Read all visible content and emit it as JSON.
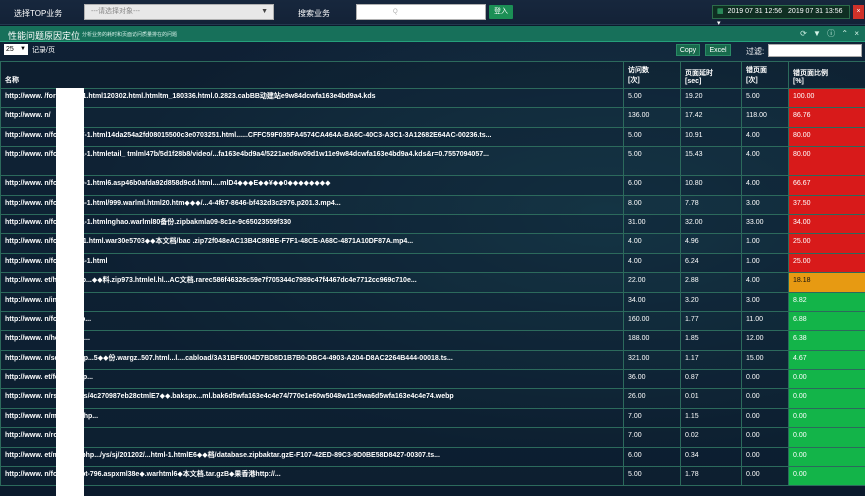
{
  "topbar": {
    "select_top_label": "选择TOP业务",
    "select_placeholder": "---请选择对象---",
    "search_label": "搜索业务",
    "search_value": "",
    "search_hint": "Q",
    "go_label": "登入",
    "time_start": "2019 07 31 12:56",
    "time_end": "2019 07 31 13:56",
    "time_caret": "▾",
    "close_label": "×"
  },
  "panel": {
    "title": "性能问题原因定位",
    "subtitle": "分析业务的耗时和页面访问质量排在的问题",
    "page_size": "25",
    "page_size_label": "记录/页",
    "copy_label": "Copy",
    "excel_label": "Excel",
    "filter_label": "过滤:"
  },
  "table": {
    "headers": {
      "name": "名称",
      "visits": "访问数",
      "visits_unit": "[次]",
      "delay": "页面延时",
      "delay_unit": "[sec]",
      "errors": "错页面",
      "errors_unit": "[次]",
      "ratio": "错页面比例",
      "ratio_unit": "[%]"
    },
    "rows": [
      {
        "name": "http://www.         /forum-131-1.html120302.html.htmltm_180336.html.0.2823.cabBB动建站e9w84dcwfa163e4bd9a4.kds",
        "visits": "5.00",
        "delay": "19.20",
        "errors": "5.00",
        "ratio": "100.00",
        "level": "red"
      },
      {
        "name": "http://www.         n/",
        "visits": "136.00",
        "delay": "17.42",
        "errors": "118.00",
        "ratio": "86.76",
        "level": "red"
      },
      {
        "name": "http://www.         n/forum-477-1.html14da254a2fd08015500c3e0703251.html......CFFC59F035FA4574CA464A-BA6C-40C3-A3C1-3A12682E64AC-00236.ts...",
        "visits": "5.00",
        "delay": "10.91",
        "errors": "4.00",
        "ratio": "80.00",
        "level": "red"
      },
      {
        "name": "http://www.         n/forum-231-1.htmletail_       tmlml47b/5d1f28b8/video/...fa163e4bd9a4/5221aed6w09d1w11e9w84dcwfa163e4bd9a4.kds&r=0.7557094057...",
        "visits": "5.00",
        "delay": "15.43",
        "errors": "4.00",
        "ratio": "80.00",
        "level": "red",
        "tall": true
      },
      {
        "name": "http://www.         n/forum-240-1.html6.asp46b0afda92d858d9cd.html....mlD4◆◆◆E◆◆¥◆◆0◆◆◆◆◆◆◆◆",
        "visits": "6.00",
        "delay": "10.80",
        "errors": "4.00",
        "ratio": "66.67",
        "level": "red"
      },
      {
        "name": "http://www.         n/forum-525-1.html/999.warlml.html20.htm◆◆◆/...4-4f67-8646-bf432d3c2976.p201.3.mp4...",
        "visits": "8.00",
        "delay": "7.78",
        "errors": "3.00",
        "ratio": "37.50",
        "level": "red"
      },
      {
        "name": "http://www.         n/forum-251-1.htmlnghao.warlml80备份.zipbakmla09-8c1e-9c65023559f330",
        "visits": "31.00",
        "delay": "32.00",
        "errors": "33.00",
        "ratio": "34.00",
        "level": "red"
      },
      {
        "name": "http://www.         n/forum-33-1.html.war30e5703◆◆本文档/bac .zip72f048eAC13B4C89BE-F7F1-48CE-A68C-4871A10DF87A.mp4...",
        "visits": "4.00",
        "delay": "4.96",
        "errors": "1.00",
        "ratio": "25.00",
        "level": "red"
      },
      {
        "name": "http://www.         n/forum-388-1.html",
        "visits": "4.00",
        "delay": "6.24",
        "errors": "1.00",
        "ratio": "25.00",
        "level": "red"
      },
      {
        "name": "http://www.         et/home.php...◆◆料.zip973.htmlel.hl...AC文档.rarec586f46326c59e7f705344c7989c47f4467dc4e7712cc969c710e...",
        "visits": "22.00",
        "delay": "2.88",
        "errors": "4.00",
        "ratio": "18.18",
        "level": "orange"
      },
      {
        "name": "http://www.         n/index.php",
        "visits": "34.00",
        "delay": "3.20",
        "errors": "3.00",
        "ratio": "8.82",
        "level": "green"
      },
      {
        "name": "http://www.         n/forum.php...",
        "visits": "160.00",
        "delay": "1.77",
        "errors": "11.00",
        "ratio": "6.88",
        "level": "green"
      },
      {
        "name": "http://www.         n/home.php...",
        "visits": "188.00",
        "delay": "1.85",
        "errors": "12.00",
        "ratio": "6.38",
        "level": "green"
      },
      {
        "name": "http://www.         n/search.php...5◆◆份.wargz..507.html...l....cabload/3A31BF6004D7BD8D1B7B0-DBC4-4903-A204-D8AC2264B444-00018.ts...",
        "visits": "321.00",
        "delay": "1.17",
        "errors": "15.00",
        "ratio": "4.67",
        "level": "green"
      },
      {
        "name": "http://www.         et/forum.php...",
        "visits": "36.00",
        "delay": "0.87",
        "errors": "0.00",
        "ratio": "0.00",
        "level": "green"
      },
      {
        "name": "http://www.         n/rss.php...ls/4c270987eb28ctmlE7◆◆.bakspx...ml.bak6d5wfa163e4c4e74/770e1e60w5048w11e9wa6d5wfa163e4c4e74.webp",
        "visits": "26.00",
        "delay": "0.01",
        "errors": "0.00",
        "ratio": "0.00",
        "level": "green"
      },
      {
        "name": "http://www.         n/member.php...",
        "visits": "7.00",
        "delay": "1.15",
        "errors": "0.00",
        "ratio": "0.00",
        "level": "green"
      },
      {
        "name": "http://www.         n/robots.txt",
        "visits": "7.00",
        "delay": "0.02",
        "errors": "0.00",
        "ratio": "0.00",
        "level": "green"
      },
      {
        "name": "http://www.         et/member.php.../ys/sj/201202/...html-1.htmlE6◆◆档/database.zipbaktar.gzE-F107-42ED-89C3-9D0BE58D8427-00307.ts...",
        "visits": "6.00",
        "delay": "0.34",
        "errors": "0.00",
        "ratio": "0.00",
        "level": "green"
      },
      {
        "name": "http://www.         n/forum.phpt-796.aspxml38e◆.warhtml6◆本文档.tar.gzB◆果香港http://...",
        "visits": "5.00",
        "delay": "1.78",
        "errors": "0.00",
        "ratio": "0.00",
        "level": "green"
      }
    ]
  },
  "colors": {
    "red": "#d81a1a",
    "orange": "#e79a12",
    "green": "#13b449",
    "header_bar": "#17705a"
  }
}
